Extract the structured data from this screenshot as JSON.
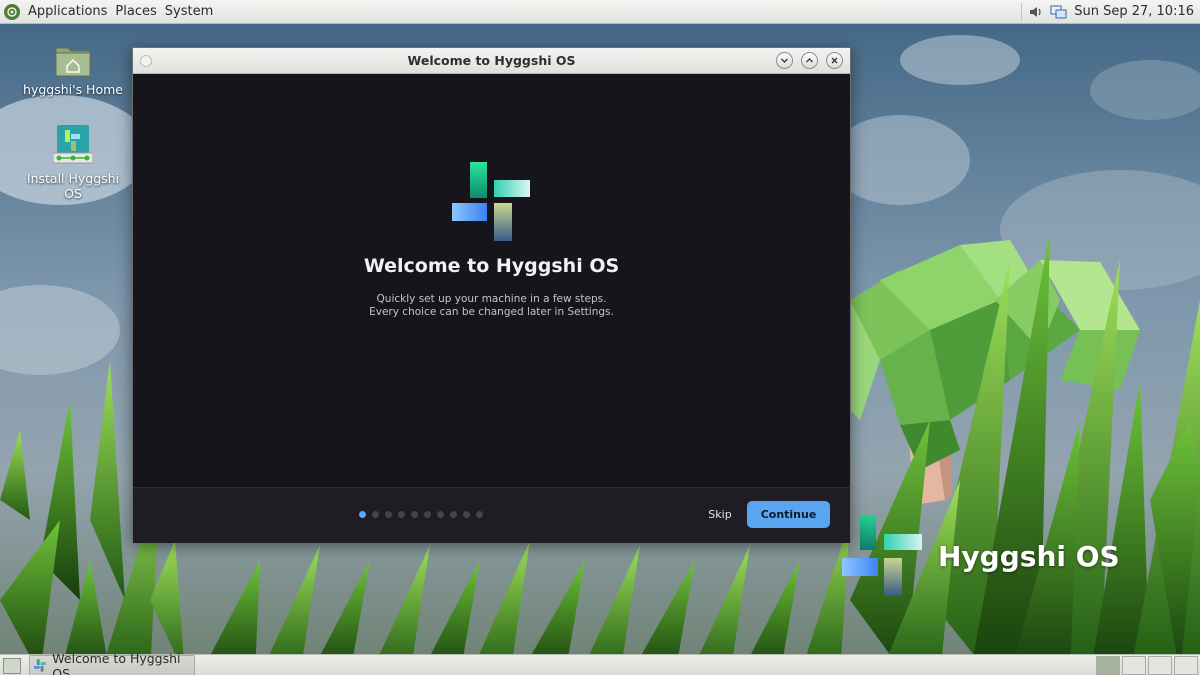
{
  "top_panel": {
    "menus": [
      "Applications",
      "Places",
      "System"
    ],
    "clock": "Sun Sep 27, 10:16"
  },
  "desktop_icons": [
    {
      "label": "hyggshi's Home"
    },
    {
      "label": "Install Hyggshi OS"
    }
  ],
  "brand": {
    "name": "Hyggshi OS"
  },
  "window": {
    "title": "Welcome to Hyggshi OS",
    "heading": "Welcome to Hyggshi OS",
    "subtitle_line1": "Quickly set up your machine in a few steps.",
    "subtitle_line2": "Every choice can be changed later in Settings.",
    "steps_total": 10,
    "step_current": 1,
    "skip_label": "Skip",
    "continue_label": "Continue"
  },
  "bottom_panel": {
    "task_label": "Welcome to Hyggshi OS",
    "workspaces": 4,
    "active_workspace": 1
  },
  "colors": {
    "accent": "#5aa5f2",
    "window_bg": "#15151b",
    "footer_bg": "#1d1d23",
    "panel_bg": "#e6e6e3"
  }
}
